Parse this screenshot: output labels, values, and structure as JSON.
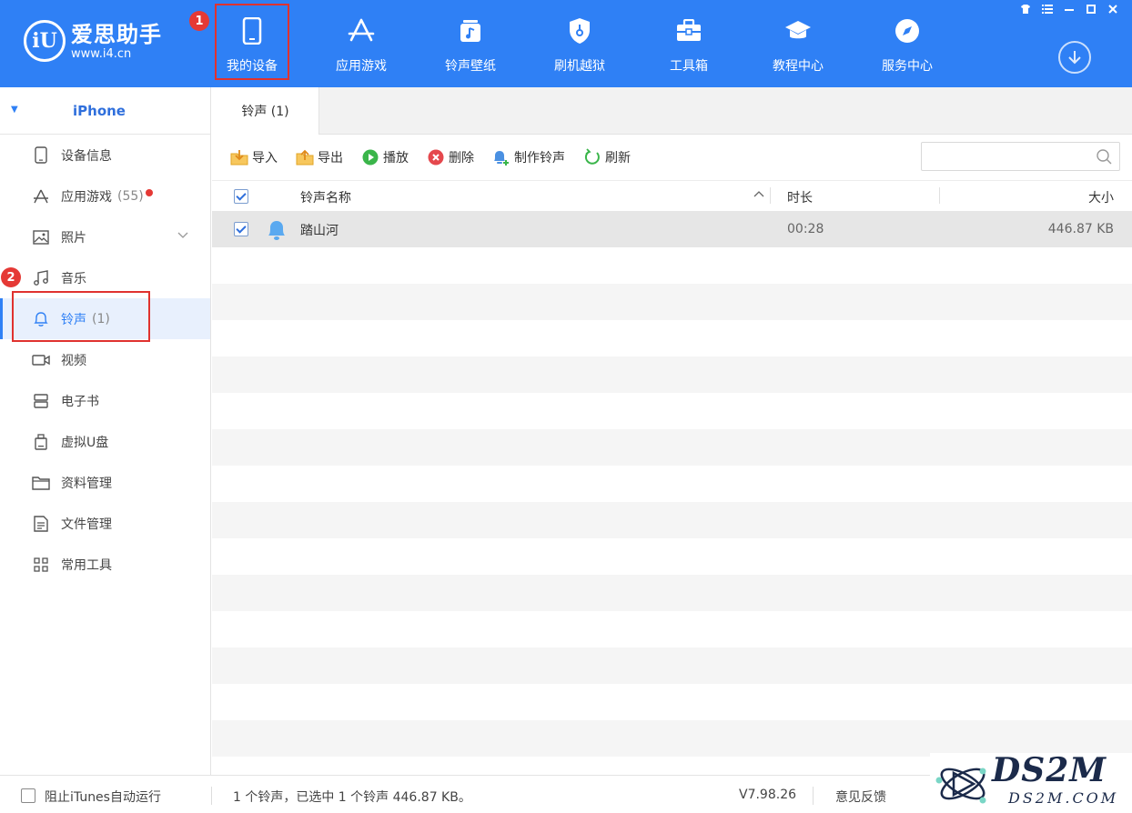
{
  "app": {
    "brand": "爱思助手",
    "url": "www.i4.cn",
    "accent": "#2f80f5",
    "annotation_color": "#e0322f"
  },
  "nav": [
    {
      "label": "我的设备",
      "icon": "phone-icon"
    },
    {
      "label": "应用游戏",
      "icon": "app-store-icon"
    },
    {
      "label": "铃声壁纸",
      "icon": "ringtone-wallpaper-icon"
    },
    {
      "label": "刷机越狱",
      "icon": "shield-key-icon"
    },
    {
      "label": "工具箱",
      "icon": "toolbox-icon"
    },
    {
      "label": "教程中心",
      "icon": "graduation-cap-icon"
    },
    {
      "label": "服务中心",
      "icon": "compass-icon"
    }
  ],
  "annotations": {
    "one": "1",
    "two": "2"
  },
  "sidebar": {
    "device": "iPhone",
    "items": [
      {
        "label": "设备信息",
        "count": ""
      },
      {
        "label": "应用游戏",
        "count": "(55)"
      },
      {
        "label": "照片",
        "count": ""
      },
      {
        "label": "音乐",
        "count": ""
      },
      {
        "label": "铃声",
        "count": "(1)"
      },
      {
        "label": "视频",
        "count": ""
      },
      {
        "label": "电子书",
        "count": ""
      },
      {
        "label": "虚拟U盘",
        "count": ""
      },
      {
        "label": "资料管理",
        "count": ""
      },
      {
        "label": "文件管理",
        "count": ""
      },
      {
        "label": "常用工具",
        "count": ""
      }
    ]
  },
  "tab": {
    "label": "铃声 (1)"
  },
  "toolbar": {
    "import": "导入",
    "export": "导出",
    "play": "播放",
    "delete": "删除",
    "make": "制作铃声",
    "refresh": "刷新",
    "search_placeholder": ""
  },
  "table": {
    "headers": {
      "name": "铃声名称",
      "duration": "时长",
      "size": "大小"
    },
    "rows": [
      {
        "name": "踏山河",
        "duration": "00:28",
        "size": "446.87 KB",
        "checked": true
      }
    ]
  },
  "status": {
    "block_itunes": "阻止iTunes自动运行",
    "summary": "1 个铃声，已选中 1 个铃声 446.87 KB。",
    "version": "V7.98.26",
    "feedback": "意见反馈"
  },
  "watermark": {
    "title": "DS2M",
    "url": "DS2M.COM"
  }
}
